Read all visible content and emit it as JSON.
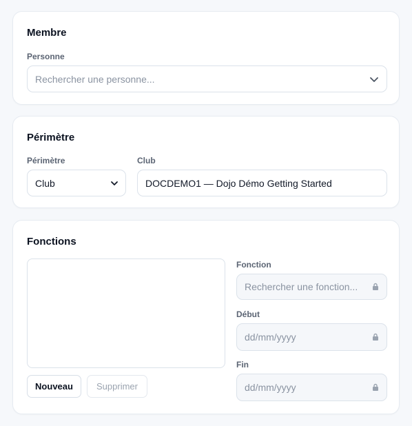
{
  "membre": {
    "title": "Membre",
    "personne_label": "Personne",
    "personne_placeholder": "Rechercher une personne..."
  },
  "perimetre": {
    "title": "Périmètre",
    "perimetre_label": "Périmètre",
    "perimetre_value": "Club",
    "club_label": "Club",
    "club_value": "DOCDEMO1 — Dojo Démo Getting Started"
  },
  "fonctions": {
    "title": "Fonctions",
    "nouveau_label": "Nouveau",
    "supprimer_label": "Supprimer",
    "fonction_label": "Fonction",
    "fonction_placeholder": "Rechercher une fonction...",
    "debut_label": "Début",
    "debut_placeholder": "dd/mm/yyyy",
    "fin_label": "Fin",
    "fin_placeholder": "dd/mm/yyyy"
  }
}
